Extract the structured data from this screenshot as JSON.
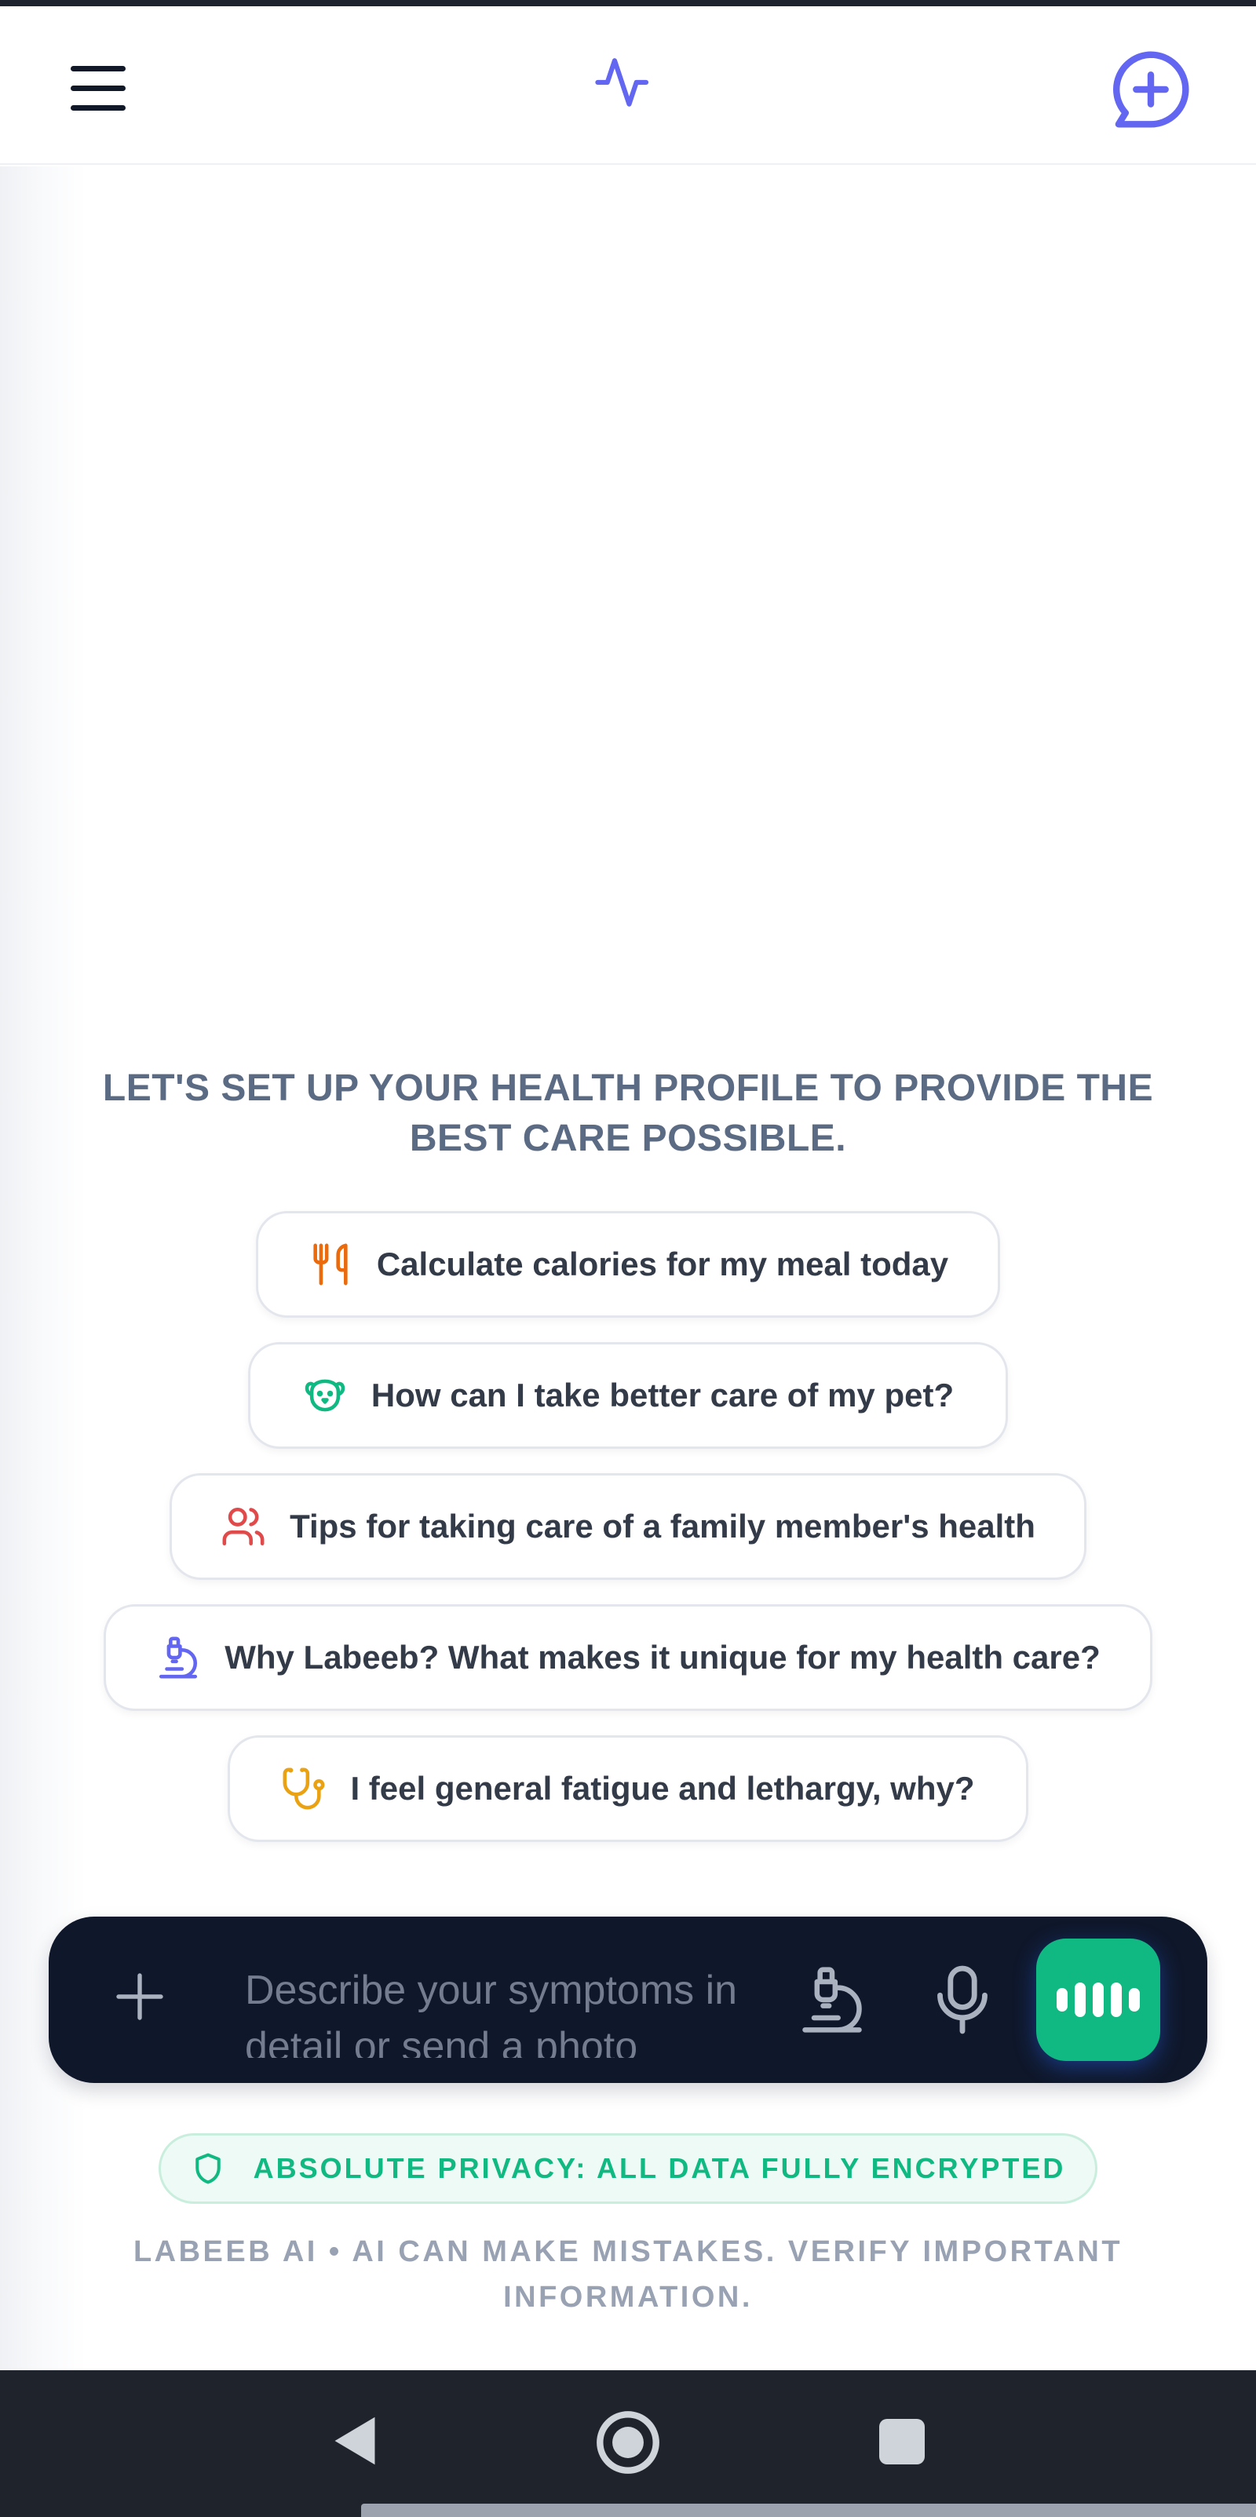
{
  "header": {
    "menu_icon": "hamburger-menu-icon",
    "logo_icon": "pulse-activity-icon",
    "new_chat_icon": "chat-plus-icon"
  },
  "main": {
    "intro_text": "LET'S SET UP YOUR HEALTH PROFILE TO PROVIDE THE BEST CARE POSSIBLE.",
    "suggestions": [
      {
        "label": "Calculate calories for my meal today",
        "icon": "utensils-icon",
        "color": "#ea6a0c"
      },
      {
        "label": "How can I take better care of my pet?",
        "icon": "dog-icon",
        "color": "#10b981"
      },
      {
        "label": "Tips for taking care of a family member's health",
        "icon": "users-icon",
        "color": "#e04a4a"
      },
      {
        "label": "Why Labeeb? What makes it unique for my health care?",
        "icon": "microscope-icon",
        "color": "#6366f1"
      },
      {
        "label": "I feel general fatigue and lethargy, why?",
        "icon": "stethoscope-icon",
        "color": "#eaa212"
      }
    ]
  },
  "composer": {
    "placeholder": "Describe your symptoms in detail or send a photo",
    "attach_icon": "plus-icon",
    "lab_icon": "microscope-icon",
    "mic_icon": "microphone-icon",
    "voice_icon": "audio-wave-icon"
  },
  "footer": {
    "privacy_text": "ABSOLUTE PRIVACY: ALL DATA FULLY ENCRYPTED",
    "disclaimer": "LABEEB AI • AI CAN MAKE MISTAKES. VERIFY IMPORTANT INFORMATION."
  },
  "colors": {
    "brand": "#6366f1",
    "accent_green": "#10b981",
    "composer_bg": "#0f172a"
  }
}
